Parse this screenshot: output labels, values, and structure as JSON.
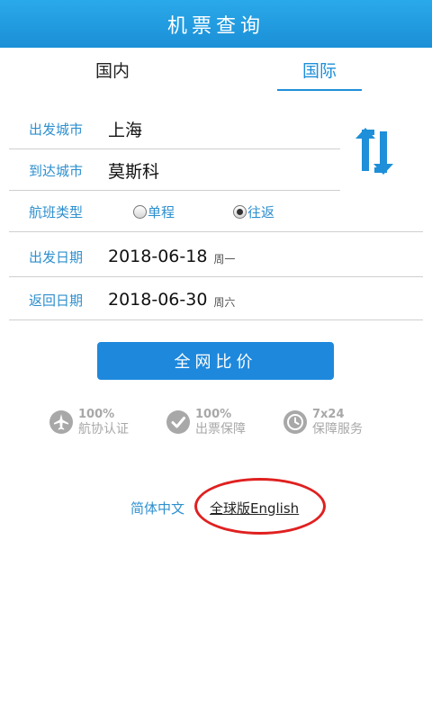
{
  "header": {
    "title": "机票查询"
  },
  "tabs": [
    {
      "label": "国内",
      "active": false
    },
    {
      "label": "国际",
      "active": true
    }
  ],
  "form": {
    "departure": {
      "label": "出发城市",
      "value": "上海"
    },
    "arrival": {
      "label": "到达城市",
      "value": "莫斯科"
    },
    "flight_type": {
      "label": "航班类型",
      "options": [
        {
          "label": "单程",
          "selected": false
        },
        {
          "label": "往返",
          "selected": true
        }
      ]
    },
    "depart_date": {
      "label": "出发日期",
      "date": "2018-06-18",
      "weekday": "周一"
    },
    "return_date": {
      "label": "返回日期",
      "date": "2018-06-30",
      "weekday": "周六"
    }
  },
  "swap_icon": "swap-vertical-arrows-icon",
  "compare_button": {
    "label": "全网比价"
  },
  "guarantees": [
    {
      "icon": "airplane-icon",
      "top": "100%",
      "bottom": "航协认证"
    },
    {
      "icon": "checkmark-icon",
      "top": "100%",
      "bottom": "出票保障"
    },
    {
      "icon": "clock-icon",
      "top": "7x24",
      "bottom": "保障服务"
    }
  ],
  "language": {
    "simplified": "简体中文",
    "global": "全球版English"
  },
  "colors": {
    "header": "#1e98e0",
    "accent": "#1e8fd8",
    "label": "#2d8fce",
    "button": "#1e88dc",
    "annotation": "#e02020"
  }
}
